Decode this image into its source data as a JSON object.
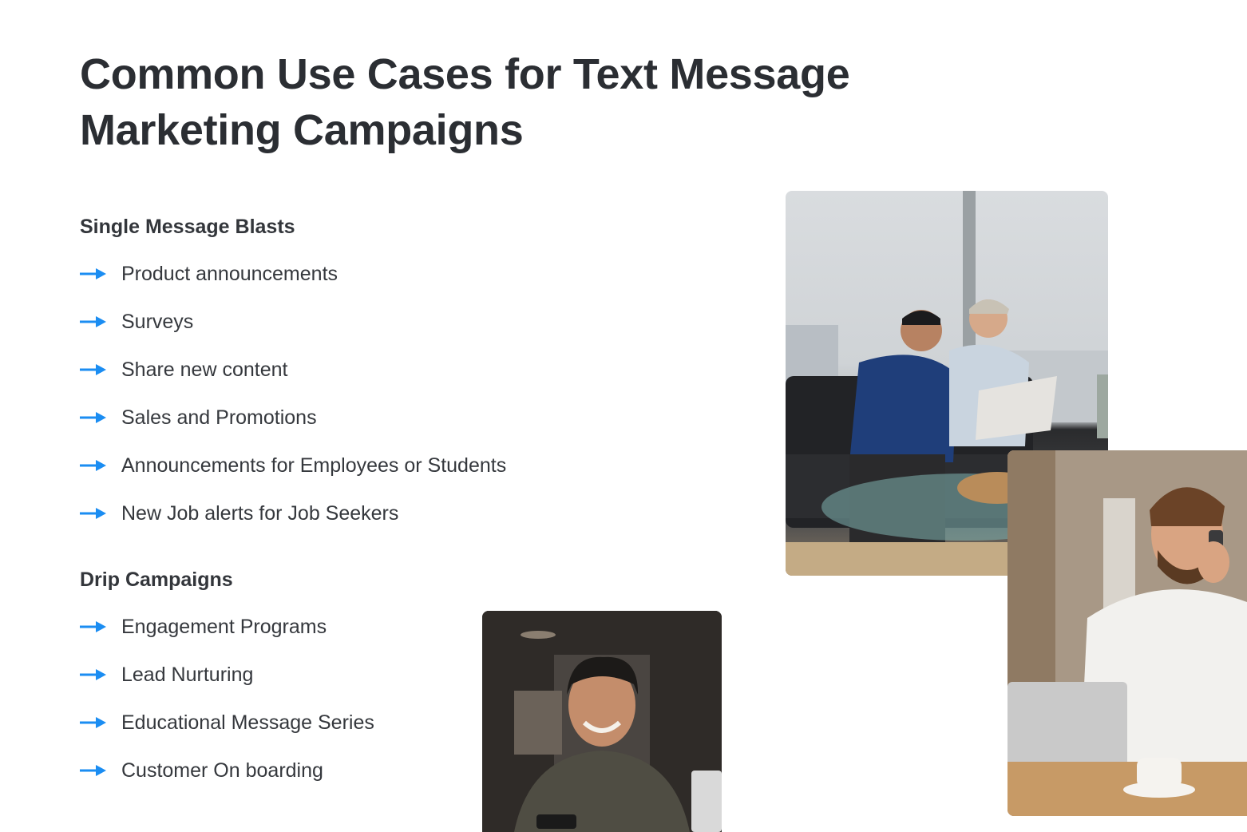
{
  "title": "Common Use Cases for Text Message Marketing Campaigns",
  "sections": [
    {
      "heading": "Single Message Blasts",
      "items": [
        "Product announcements",
        "Surveys",
        "Share new content",
        "Sales and Promotions",
        "Announcements for Employees or Students",
        "New Job alerts for Job Seekers"
      ]
    },
    {
      "heading": "Drip Campaigns",
      "items": [
        "Engagement Programs",
        "Lead Nurturing",
        "Educational Message Series",
        "Customer On boarding"
      ]
    }
  ],
  "icons": {
    "bullet": "arrow-right-icon"
  },
  "colors": {
    "accent": "#1b8df2",
    "text": "#2b2e33"
  }
}
